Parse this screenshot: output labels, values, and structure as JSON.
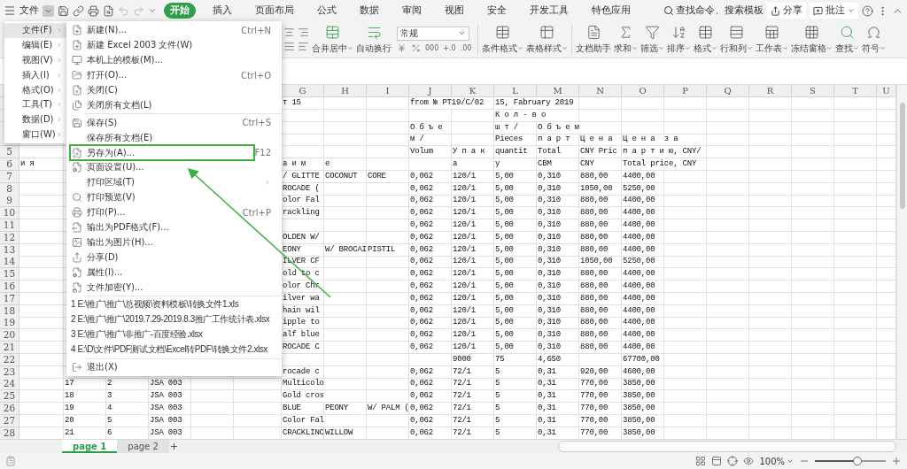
{
  "file_menu": {
    "label": "文件",
    "open": true
  },
  "tabs": [
    {
      "label": "开始",
      "selected": true
    },
    {
      "label": "插入",
      "selected": false
    },
    {
      "label": "页面布局",
      "selected": false
    },
    {
      "label": "公式",
      "selected": false
    },
    {
      "label": "数据",
      "selected": false
    },
    {
      "label": "审阅",
      "selected": false
    },
    {
      "label": "视图",
      "selected": false
    },
    {
      "label": "安全",
      "selected": false
    },
    {
      "label": "开发工具",
      "selected": false
    },
    {
      "label": "特色应用",
      "selected": false
    }
  ],
  "search": {
    "label": "查找命令、搜索模板"
  },
  "share": {
    "label": "分享"
  },
  "comment": {
    "label": "批注"
  },
  "ribbon": {
    "merge": [
      {
        "label": "合并居中",
        "dropdown": true
      },
      {
        "label": "自动换行",
        "dropdown": false
      }
    ],
    "number_format": "常规",
    "number_tools": [
      "000",
      "+.0",
      ".00"
    ],
    "buttons": [
      {
        "label": "条件格式",
        "dropdown": true
      },
      {
        "label": "表格样式",
        "dropdown": true
      },
      {
        "label": "文档助手",
        "dropdown": false
      },
      {
        "label": "求和",
        "dropdown": true
      },
      {
        "label": "筛选",
        "dropdown": true
      },
      {
        "label": "排序",
        "dropdown": true
      },
      {
        "label": "格式",
        "dropdown": true
      },
      {
        "label": "行和列",
        "dropdown": true
      },
      {
        "label": "工作表",
        "dropdown": true
      },
      {
        "label": "冻结窗格",
        "dropdown": true
      },
      {
        "label": "查找",
        "dropdown": true
      },
      {
        "label": "符号",
        "dropdown": true
      }
    ]
  },
  "menu_categories": [
    {
      "label": "文件(F)",
      "selected": true
    },
    {
      "label": "编辑(E)",
      "selected": false
    },
    {
      "label": "视图(V)",
      "selected": false
    },
    {
      "label": "插入(I)",
      "selected": false
    },
    {
      "label": "格式(O)",
      "selected": false
    },
    {
      "label": "工具(T)",
      "selected": false
    },
    {
      "label": "数据(D)",
      "selected": false
    },
    {
      "label": "窗口(W)",
      "selected": false
    }
  ],
  "menu_items": [
    {
      "kind": "command",
      "label": "新建(N)...",
      "shortcut": "Ctrl+N"
    },
    {
      "kind": "command",
      "label": "新建 Excel 2003 文件(W)"
    },
    {
      "kind": "command",
      "label": "本机上的模板(M)..."
    },
    {
      "kind": "command",
      "label": "打开(O)...",
      "shortcut": "Ctrl+O"
    },
    {
      "kind": "command",
      "label": "关闭(C)"
    },
    {
      "kind": "command",
      "label": "关闭所有文档(L)"
    },
    {
      "kind": "separator"
    },
    {
      "kind": "command",
      "label": "保存(S)",
      "shortcut": "Ctrl+S"
    },
    {
      "kind": "text",
      "label": "保存所有文档(E)"
    },
    {
      "kind": "command",
      "label": "另存为(A)...",
      "shortcut": "F12",
      "annotated": true
    },
    {
      "kind": "command",
      "label": "页面设置(U)..."
    },
    {
      "kind": "text",
      "label": "打印区域(T)",
      "submenu": true
    },
    {
      "kind": "command",
      "label": "打印预览(V)"
    },
    {
      "kind": "command",
      "label": "打印(P)...",
      "shortcut": "Ctrl+P"
    },
    {
      "kind": "command",
      "label": "输出为PDF格式(F)..."
    },
    {
      "kind": "command",
      "label": "输出为图片(H)..."
    },
    {
      "kind": "command",
      "label": "分享(D)"
    },
    {
      "kind": "command",
      "label": "属性(I)..."
    },
    {
      "kind": "command",
      "label": "文件加密(Y)..."
    },
    {
      "kind": "separator"
    },
    {
      "kind": "recent",
      "label": "1 E:\\推广\\推广\\总视频\\资料模板\\转换文件1.xls"
    },
    {
      "kind": "recent",
      "label": "2 E:\\推广\\推广\\2019.7.29-2019.8.3推广工作统计表.xlsx"
    },
    {
      "kind": "recent",
      "label": "3 E:\\推广\\推广\\非推广-百度经验.xlsx"
    },
    {
      "kind": "recent",
      "label": "4 E:\\D\\文件\\PDF测试文档\\Excel转PDF\\转换文件2.xlsx"
    },
    {
      "kind": "separator"
    },
    {
      "kind": "command",
      "label": "退出(X)"
    }
  ],
  "sheet": {
    "columns": [
      "G",
      "H",
      "I",
      "J",
      "K",
      "L",
      "M",
      "N",
      "O",
      "P",
      "Q",
      "R",
      "S",
      "T",
      "U"
    ],
    "rows": [
      {
        "cells": {
          "G": "т 15",
          "J": "from № PT19/C/02",
          "L": "15, Fabruary 2019"
        }
      },
      {
        "cells": {
          "L": "К о л - в о"
        }
      },
      {
        "cells": {
          "J": "О б ъ е",
          "L": "ш т /",
          "M": "О б ъ е м"
        }
      },
      {
        "cells": {
          "J": "м /",
          "L": "Pieces",
          "M": "п а р т",
          "N": "Ц е н а",
          "O": "Ц е н а  з а"
        }
      },
      {
        "number": "5",
        "cells": {
          "J": "Volum",
          "K": "У п а к",
          "L": "quantit",
          "M": "Total",
          "N": "CNY Pric",
          "O": "п а р т и ю, CNY/"
        }
      },
      {
        "number": "6",
        "cells": {
          "A": "и я",
          "G": "а и м",
          "H": "е",
          "K": "а",
          "L": "y",
          "M": "CBM",
          "N": "CNY",
          "O": "Total price, CNY"
        }
      },
      {
        "number": "7",
        "cells": {
          "G": "/ GLITTE",
          "H": "COCONUT",
          "I": "CORE",
          "J": "0,062",
          "K": "120/1",
          "L": "5,00",
          "M": "0,310",
          "N": "880,00",
          "O": "4400,00"
        }
      },
      {
        "number": "8",
        "cells": {
          "G": "ROCADE (",
          "J": "0,062",
          "K": "120/1",
          "L": "5,00",
          "M": "0,310",
          "N": "1050,00",
          "O": "5250,00"
        }
      },
      {
        "number": "9",
        "cells": {
          "G": "olor Fal",
          "J": "0,062",
          "K": "120/1",
          "L": "5,00",
          "M": "0,310",
          "N": "880,00",
          "O": "4400,00"
        }
      },
      {
        "number": "10",
        "cells": {
          "G": "rackling",
          "J": "0,062",
          "K": "120/1",
          "L": "5,00",
          "M": "0,310",
          "N": "880,00",
          "O": "4400,00"
        }
      },
      {
        "number": "11",
        "cells": {
          "J": "0,062",
          "K": "120/1",
          "L": "5,00",
          "M": "0,310",
          "N": "880,00",
          "O": "4400,00"
        }
      },
      {
        "number": "12",
        "cells": {
          "G": "OLDEN W/",
          "J": "0,062",
          "K": "120/1",
          "L": "5,00",
          "M": "0,310",
          "N": "880,00",
          "O": "4400,00"
        }
      },
      {
        "number": "13",
        "cells": {
          "G": "EONY",
          "H": "W/ BROCAI",
          "I": "PISTIL",
          "J": "0,062",
          "K": "120/1",
          "L": "5,00",
          "M": "0,310",
          "N": "880,00",
          "O": "4400,00"
        }
      },
      {
        "number": "14",
        "cells": {
          "G": "ILVER CF",
          "J": "0,062",
          "K": "120/1",
          "L": "5,00",
          "M": "0,310",
          "N": "1050,00",
          "O": "5250,00"
        }
      },
      {
        "number": "15",
        "cells": {
          "G": "old to c",
          "J": "0,062",
          "K": "120/1",
          "L": "5,00",
          "M": "0,310",
          "N": "880,00",
          "O": "4400,00"
        }
      },
      {
        "number": "16",
        "cells": {
          "G": "olor Chr",
          "J": "0,062",
          "K": "120/1",
          "L": "5,00",
          "M": "0,310",
          "N": "880,00",
          "O": "4400,00"
        }
      },
      {
        "number": "17",
        "cells": {
          "G": "ilver wa",
          "J": "0,062",
          "K": "120/1",
          "L": "5,00",
          "M": "0,310",
          "N": "880,00",
          "O": "4400,00"
        }
      },
      {
        "number": "18",
        "cells": {
          "G": "hain wil",
          "J": "0,062",
          "K": "120/1",
          "L": "5,00",
          "M": "0,310",
          "N": "880,00",
          "O": "4400,00"
        }
      },
      {
        "number": "19",
        "cells": {
          "G": "ipple to",
          "J": "0,062",
          "K": "120/1",
          "L": "5,00",
          "M": "0,310",
          "N": "880,00",
          "O": "4400,00"
        }
      },
      {
        "number": "20",
        "cells": {
          "G": "alf blue",
          "J": "0,062",
          "K": "120/1",
          "L": "5,00",
          "M": "0,310",
          "N": "880,00",
          "O": "4400,00"
        }
      },
      {
        "number": "21",
        "cells": {
          "G": "ROCADE C",
          "J": "0,062",
          "K": "120/1",
          "L": "5,00",
          "M": "0,310",
          "N": "880,00",
          "O": "4400,00"
        }
      },
      {
        "number": "22",
        "cells": {
          "K": "9000",
          "L": "75",
          "M": "4,650",
          "O": "67700,00"
        }
      },
      {
        "number": "23",
        "cells": {
          "G": "rocade c",
          "J": "0,062",
          "K": "72/1",
          "L": "5",
          "M": "0,31",
          "N": "920,00",
          "O": "4600,00"
        }
      },
      {
        "number": "24",
        "cells": {
          "B": "17",
          "C": "2",
          "D": "JSA 003",
          "G": "Multicolo",
          "J": "0,062",
          "K": "72/1",
          "L": "5",
          "M": "0,31",
          "N": "770,00",
          "O": "3850,00"
        }
      },
      {
        "number": "25",
        "cells": {
          "B": "18",
          "C": "3",
          "D": "JSA 003",
          "G": "Gold cros",
          "J": "0,062",
          "K": "72/1",
          "L": "5",
          "M": "0,31",
          "N": "770,00",
          "O": "3850,00"
        }
      },
      {
        "number": "26",
        "cells": {
          "B": "19",
          "C": "4",
          "D": "JSA 003",
          "G": "BLUE",
          "H": "PEONY",
          "I": "W/ PALM (",
          "J": "0,062",
          "K": "72/1",
          "L": "5",
          "M": "0,31",
          "N": "770,00",
          "O": "3850,00"
        }
      },
      {
        "number": "27",
        "cells": {
          "B": "20",
          "C": "5",
          "D": "JSA 003",
          "G": "Color Fal",
          "J": "0,062",
          "K": "72/1",
          "L": "5",
          "M": "0,31",
          "N": "770,00",
          "O": "3850,00"
        }
      },
      {
        "number": "28",
        "cells": {
          "B": "21",
          "C": "6",
          "D": "JSA 003",
          "G": "CRACKLINC",
          "H": "WILLOW",
          "J": "0,062",
          "K": "72/1",
          "L": "5",
          "M": "0,31",
          "N": "770,00",
          "O": "3850,00"
        }
      }
    ]
  },
  "sheet_tabs": [
    {
      "label": "page 1",
      "selected": true
    },
    {
      "label": "page 2",
      "selected": false
    }
  ],
  "zoom": {
    "label": "100%",
    "level": 0.6
  }
}
